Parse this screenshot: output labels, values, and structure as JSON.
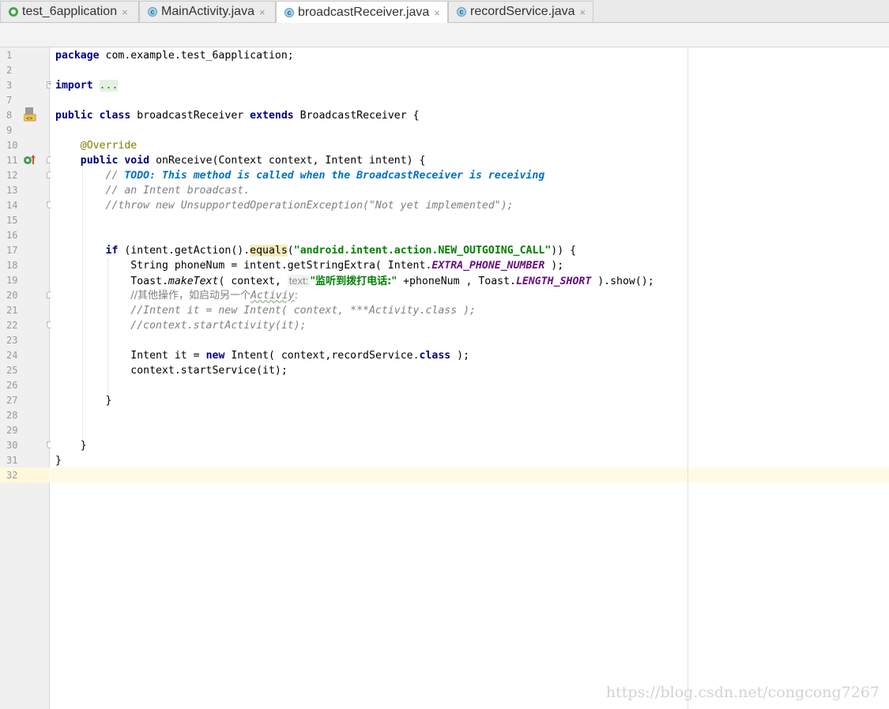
{
  "tabs": [
    {
      "label": "test_6application",
      "icon": "project-icon",
      "active": false
    },
    {
      "label": "MainActivity.java",
      "icon": "java-class-icon",
      "active": false
    },
    {
      "label": "broadcastReceiver.java",
      "icon": "java-class-icon",
      "active": true
    },
    {
      "label": "recordService.java",
      "icon": "java-class-icon",
      "active": false
    }
  ],
  "tab_close_glyph": "×",
  "java_icon_letter": "c",
  "line_numbers": [
    "1",
    "2",
    "3",
    "7",
    "8",
    "9",
    "10",
    "11",
    "12",
    "13",
    "14",
    "15",
    "16",
    "17",
    "18",
    "19",
    "20",
    "21",
    "22",
    "23",
    "24",
    "25",
    "26",
    "27",
    "28",
    "29",
    "30",
    "31",
    "32"
  ],
  "code": {
    "l1_kw": "package",
    "l1_rest": " com.example.test_6application;",
    "l3_kw": "import",
    "l3_fold": "...",
    "l8_kw1": "public",
    "l8_kw2": "class",
    "l8_name": " broadcastReceiver ",
    "l8_kw3": "extends",
    "l8_rest": " BroadcastReceiver {",
    "l10_ann": "@Override",
    "l11_kw1": "public",
    "l11_kw2": "void",
    "l11_rest": " onReceive(Context context, Intent intent) {",
    "l12_cmt": "// ",
    "l12_todo": "TODO: This method is called when the BroadcastReceiver is receiving",
    "l13_cmt": "// an Intent broadcast.",
    "l14_cmt": "//throw new UnsupportedOperationException(\"Not yet implemented\");",
    "l17_kw": "if",
    "l17_a": " (intent.getAction().",
    "l17_hl": "equals",
    "l17_b": "(",
    "l17_str": "\"android.intent.action.NEW_OUTGOING_CALL\"",
    "l17_c": ")) {",
    "l18_a": "String phoneNum = intent.getStringExtra( Intent.",
    "l18_cst": "EXTRA_PHONE_NUMBER",
    "l18_b": " );",
    "l19_a": "Toast.",
    "l19_it": "makeText",
    "l19_b": "( context, ",
    "l19_hint": "text:",
    "l19_str": "\"监听到拨打电话:\"",
    "l19_c": " +phoneNum , Toast.",
    "l19_cst": "LENGTH_SHORT",
    "l19_d": " ).show();",
    "l20_cmt": "//其他操作，如启动另一个",
    "l20_typo": "Activiy",
    "l20_end": ":",
    "l21_cmt": "//Intent it = new Intent( context, ***Activity.class );",
    "l22_cmt": "//context.startActivity(it);",
    "l24_a": "Intent it = ",
    "l24_kw": "new",
    "l24_b": " Intent( context,recordService.",
    "l24_kw2": "class",
    "l24_c": " );",
    "l25": "context.startService(it);",
    "l27": "}",
    "l30": "}",
    "l31": "}"
  },
  "watermark": "https://blog.csdn.net/congcong7267",
  "colors": {
    "keyword": "#000080",
    "string": "#008000",
    "comment": "#808080",
    "todo": "#0073bf",
    "annotation": "#808000",
    "constant": "#660e7a"
  }
}
